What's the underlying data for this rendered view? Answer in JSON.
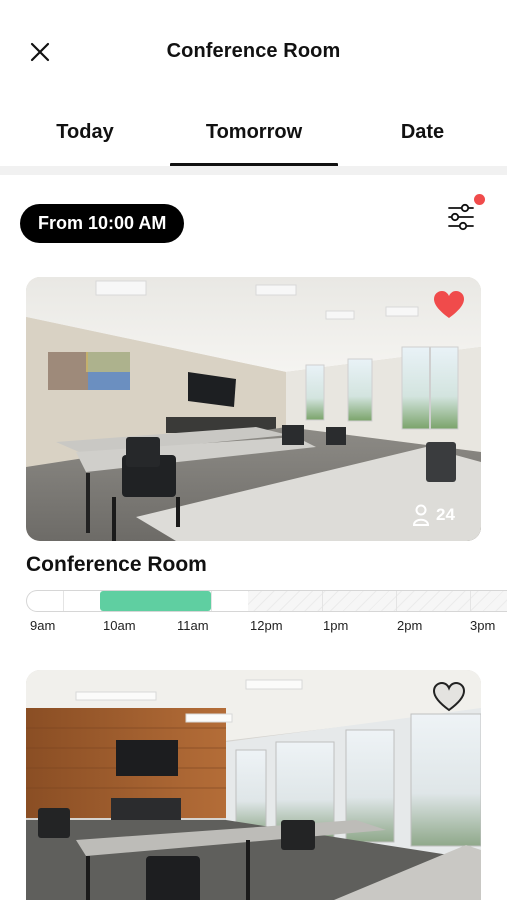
{
  "header": {
    "title": "Conference Room",
    "close_icon": "close-icon"
  },
  "tabs": [
    {
      "label": "Today",
      "selected": false
    },
    {
      "label": "Tomorrow",
      "selected": true
    },
    {
      "label": "Date",
      "selected": false
    }
  ],
  "filters": {
    "time_pill": "From 10:00 AM",
    "filter_icon": "sliders-icon",
    "has_active_filter": true
  },
  "rooms": [
    {
      "name": "Conference Room",
      "favorite": true,
      "capacity": "24",
      "timeline": {
        "labels": [
          "9am",
          "10am",
          "11am",
          "12pm",
          "1pm",
          "2pm",
          "3pm"
        ],
        "booked": {
          "start": "10am",
          "end": "11:30am",
          "color": "#5fcfa1"
        },
        "unavailable_from": "12pm"
      }
    },
    {
      "favorite": false
    }
  ],
  "colors": {
    "favorite": "#f04b4b",
    "accent": "#5fcfa1",
    "dot": "#f04b4b"
  }
}
